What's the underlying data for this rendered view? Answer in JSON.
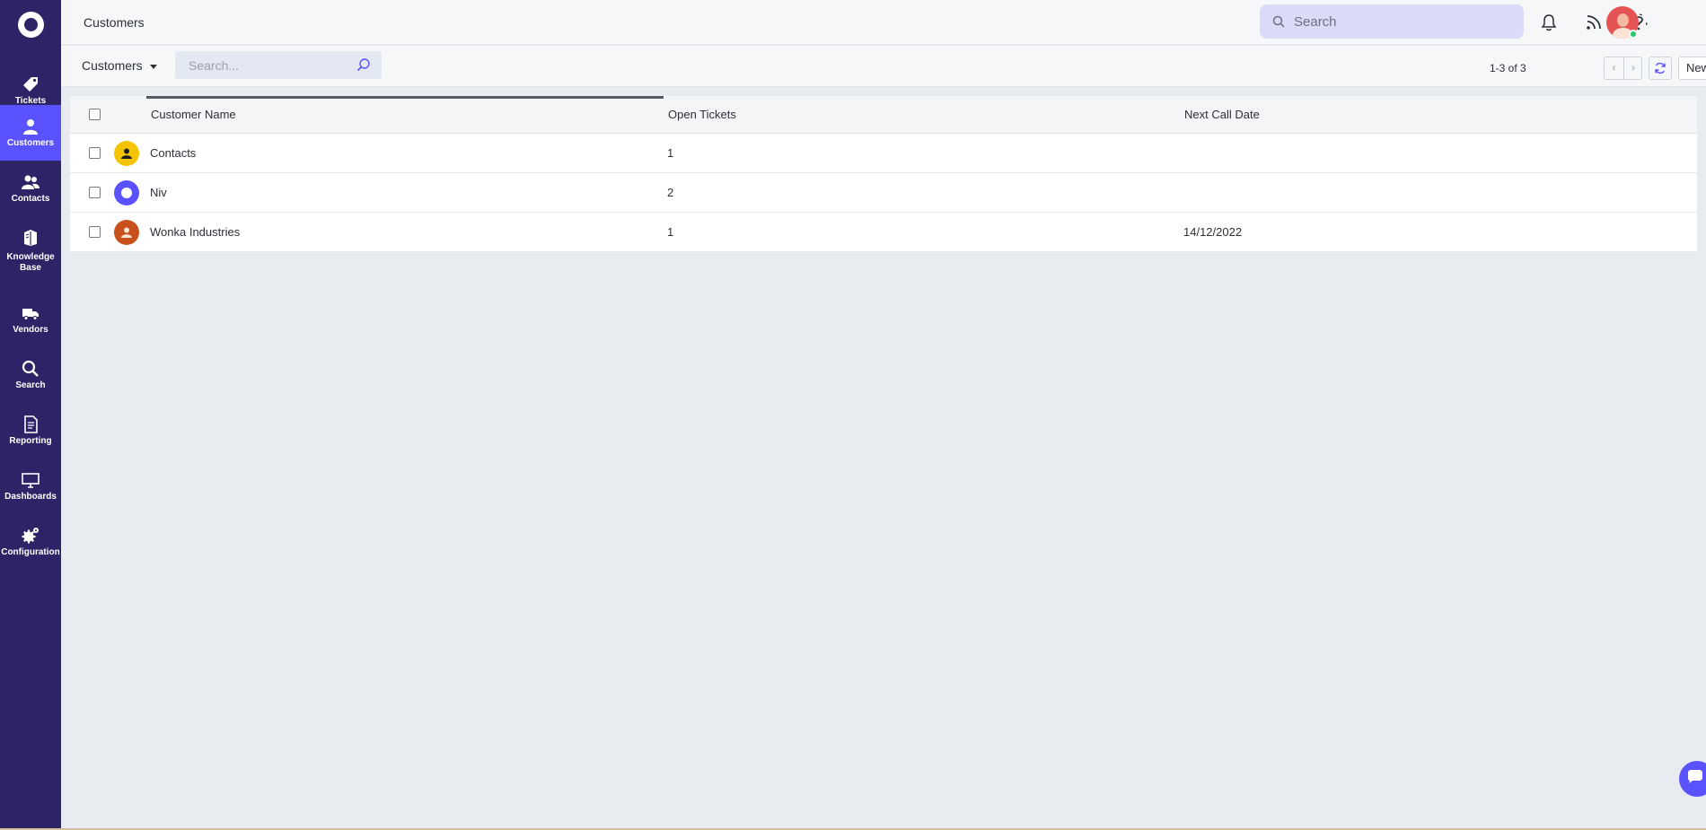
{
  "sidebar": {
    "items": [
      {
        "label": "Tickets",
        "icon": "tag-icon"
      },
      {
        "label": "Customers",
        "icon": "customer-icon",
        "active": true
      },
      {
        "label": "Contacts",
        "icon": "contacts-icon"
      },
      {
        "label": "Knowledge Base",
        "icon": "book-icon"
      },
      {
        "label": "Vendors",
        "icon": "truck-icon"
      },
      {
        "label": "Search",
        "icon": "search-icon"
      },
      {
        "label": "Reporting",
        "icon": "report-icon"
      },
      {
        "label": "Dashboards",
        "icon": "monitor-icon"
      },
      {
        "label": "Configuration",
        "icon": "gear-icon"
      }
    ]
  },
  "header": {
    "title": "Customers",
    "search_placeholder": "Search"
  },
  "toolbar": {
    "view_label": "Customers",
    "search_placeholder": "Search...",
    "pager_text": "1-3 of 3",
    "new_label": "New",
    "more_label": "•••",
    "prev_label": "‹",
    "next_label": "›"
  },
  "table": {
    "columns": [
      "Customer Name",
      "Open Tickets",
      "Next Call Date"
    ],
    "rows": [
      {
        "name": "Contacts",
        "open_tickets": "1",
        "next_call_date": "",
        "avatar_color": "#f5c400"
      },
      {
        "name": "Niv",
        "open_tickets": "2",
        "next_call_date": "",
        "avatar_color": "#5a52ff"
      },
      {
        "name": "Wonka Industries",
        "open_tickets": "1",
        "next_call_date": "14/12/2022",
        "avatar_color": "#c8501a"
      }
    ]
  },
  "colors": {
    "sidebar_bg": "#2c2466",
    "accent": "#5a52ff",
    "page_bg": "#e8ebf0"
  }
}
